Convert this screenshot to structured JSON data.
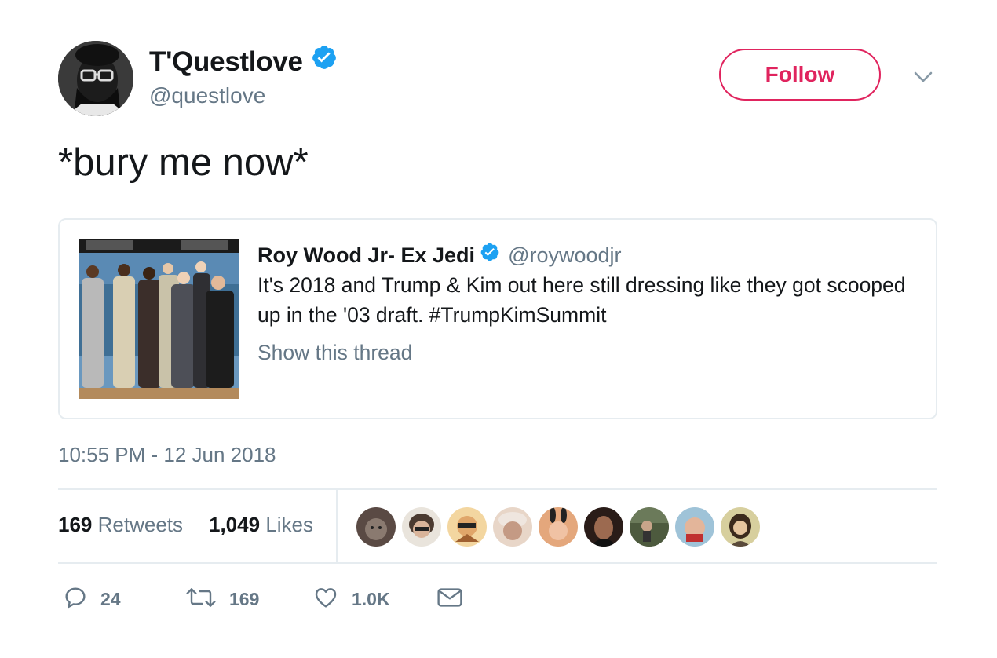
{
  "author": {
    "display_name": "T'Questlove",
    "handle": "@questlove",
    "verified": true
  },
  "follow_label": "Follow",
  "tweet_text": "*bury me now*",
  "quoted": {
    "display_name": "Roy Wood Jr- Ex Jedi",
    "handle": "@roywoodjr",
    "text": "It's 2018 and Trump & Kim out here still dressing like they got scooped up in the '03 draft. #TrumpKimSummit",
    "show_thread": "Show this thread"
  },
  "timestamp": "10:55 PM - 12 Jun 2018",
  "stats": {
    "retweets_count": "169",
    "retweets_label": "Retweets",
    "likes_count": "1,049",
    "likes_label": "Likes"
  },
  "actions": {
    "reply_count": "24",
    "retweet_count": "169",
    "like_count": "1.0K"
  },
  "icons": [
    "verified-badge-icon",
    "chevron-down-icon",
    "reply-icon",
    "retweet-icon",
    "like-icon",
    "message-icon"
  ],
  "colors": {
    "follow": "#e0245e",
    "verified": "#1da1f2",
    "secondary_text": "#657786",
    "border": "#e6ecf0"
  }
}
